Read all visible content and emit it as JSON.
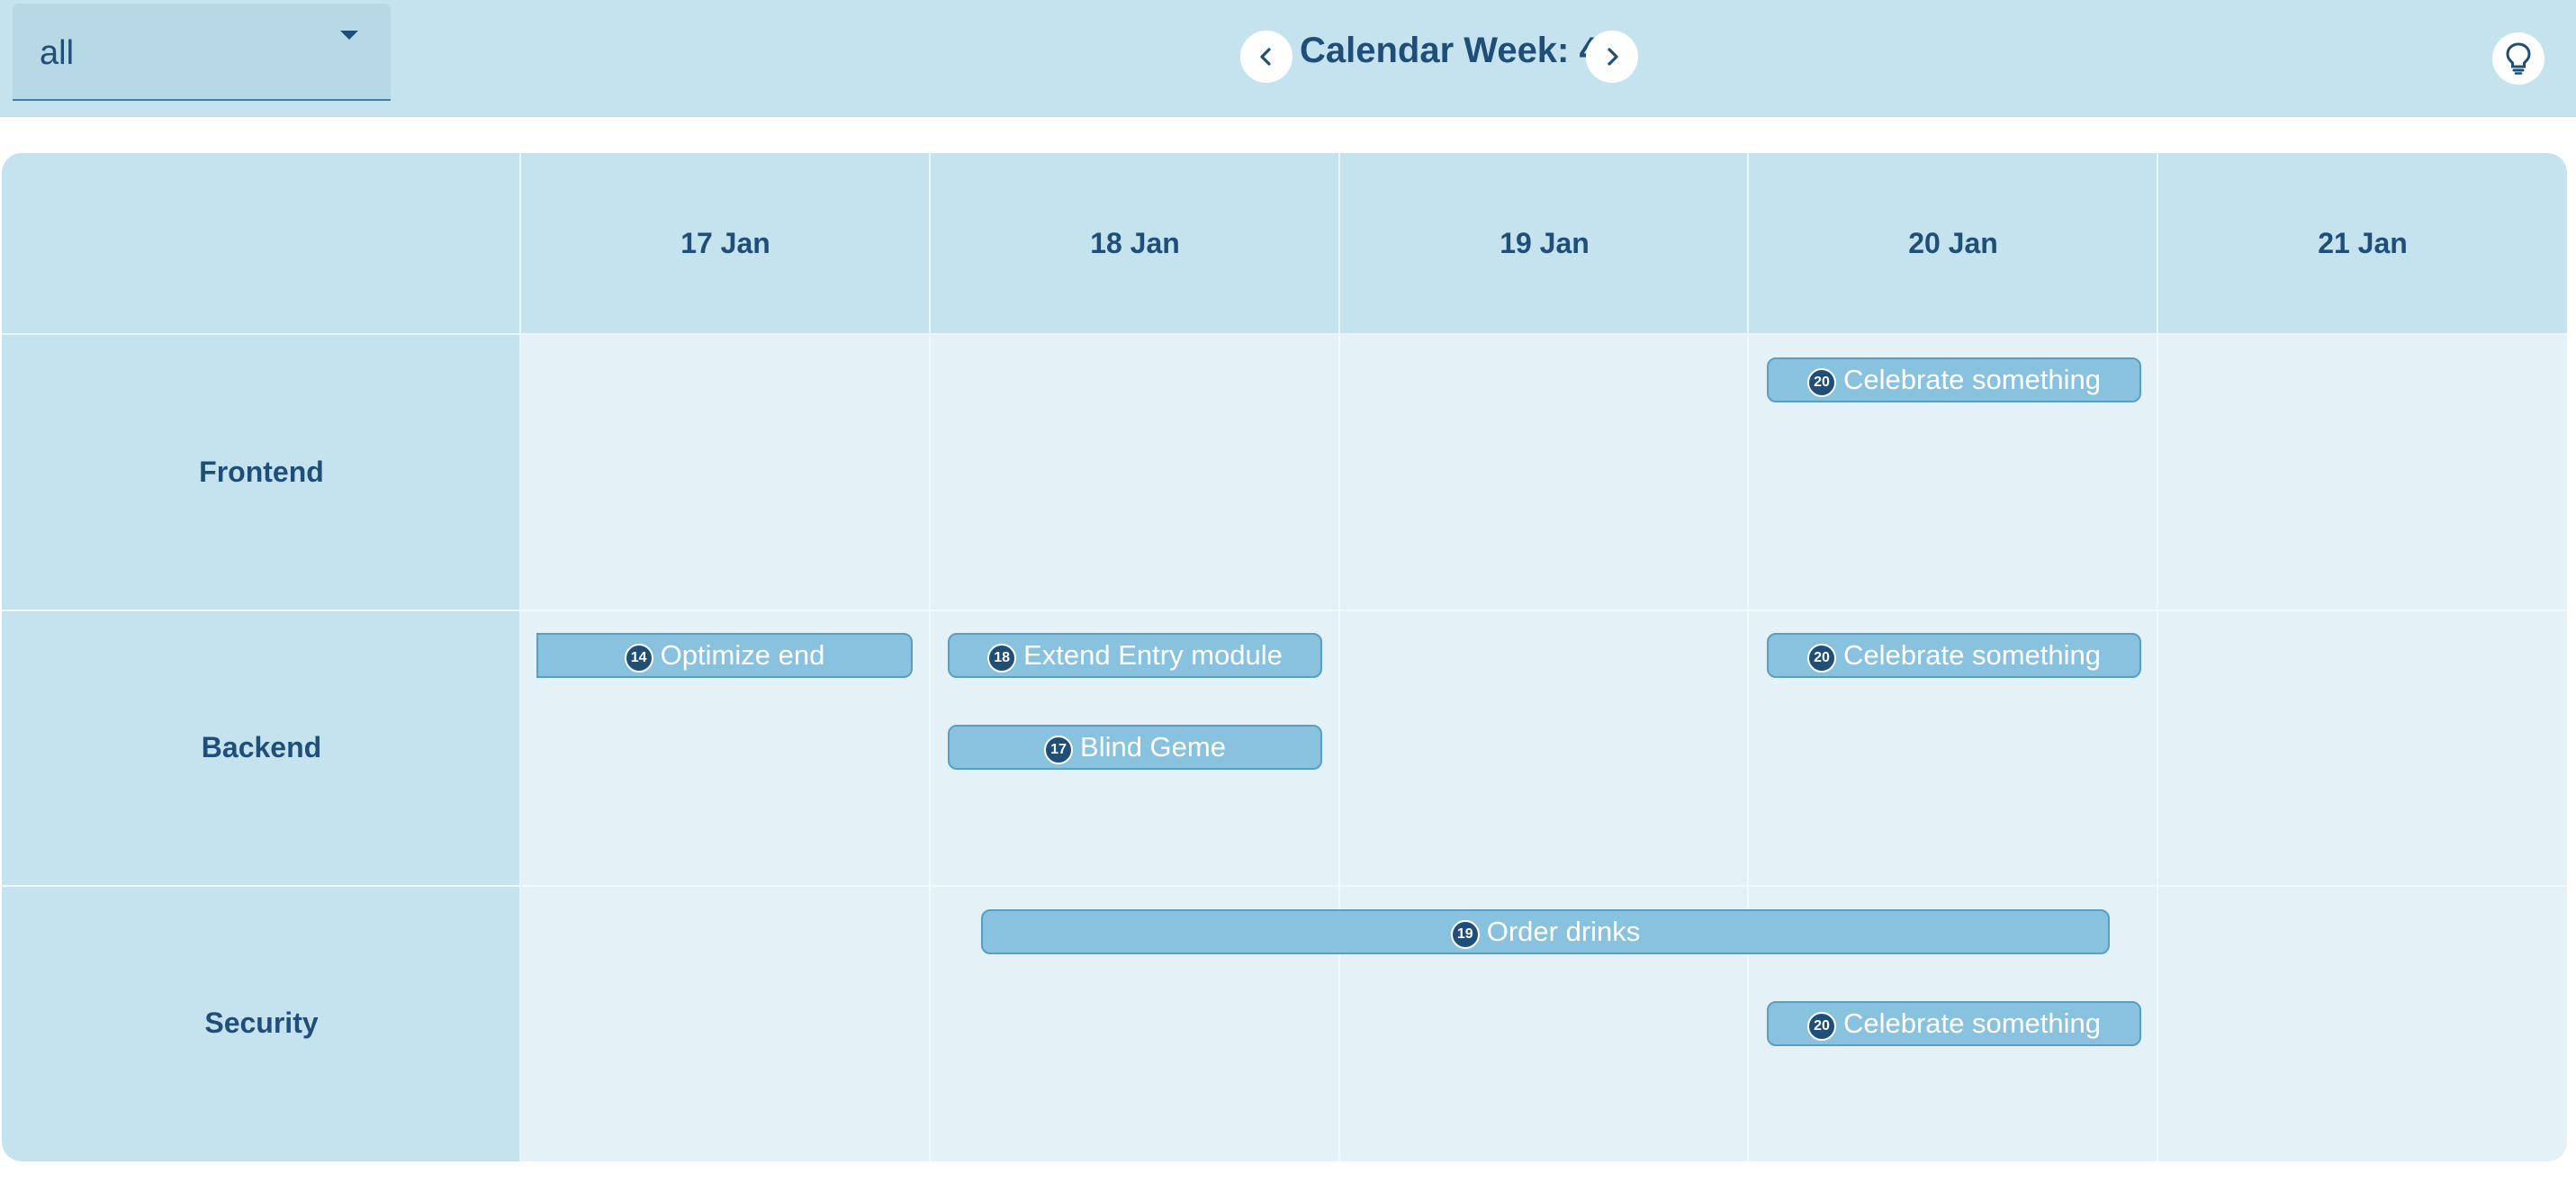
{
  "header": {
    "filter_value": "all",
    "week_title": "Calendar Week: 4"
  },
  "days": [
    "17 Jan",
    "18 Jan",
    "19 Jan",
    "20 Jan",
    "21 Jan"
  ],
  "rows": [
    "Frontend",
    "Backend",
    "Security"
  ],
  "events": [
    {
      "id": "20",
      "label": "Celebrate something",
      "row": "Frontend",
      "day": "20 Jan"
    },
    {
      "id": "14",
      "label": "Optimize end",
      "row": "Backend",
      "day": "17 Jan"
    },
    {
      "id": "18",
      "label": "Extend Entry module",
      "row": "Backend",
      "day": "18 Jan"
    },
    {
      "id": "17",
      "label": "Blind Geme",
      "row": "Backend",
      "day": "18 Jan"
    },
    {
      "id": "20",
      "label": "Celebrate something",
      "row": "Backend",
      "day": "20 Jan"
    },
    {
      "id": "19",
      "label": "Order drinks",
      "row": "Security",
      "day": "18 Jan – 20 Jan"
    },
    {
      "id": "20",
      "label": "Celebrate something",
      "row": "Security",
      "day": "20 Jan"
    }
  ],
  "colors": {
    "header_bg": "#c5e3ee",
    "cell_bg": "#e4f2f7",
    "event_bg": "#89c2df",
    "badge_bg": "#1f4e79",
    "text": "#1f4e79"
  },
  "icons": [
    "chevron-down-icon",
    "chevron-left-icon",
    "chevron-right-icon",
    "lightbulb-icon"
  ]
}
